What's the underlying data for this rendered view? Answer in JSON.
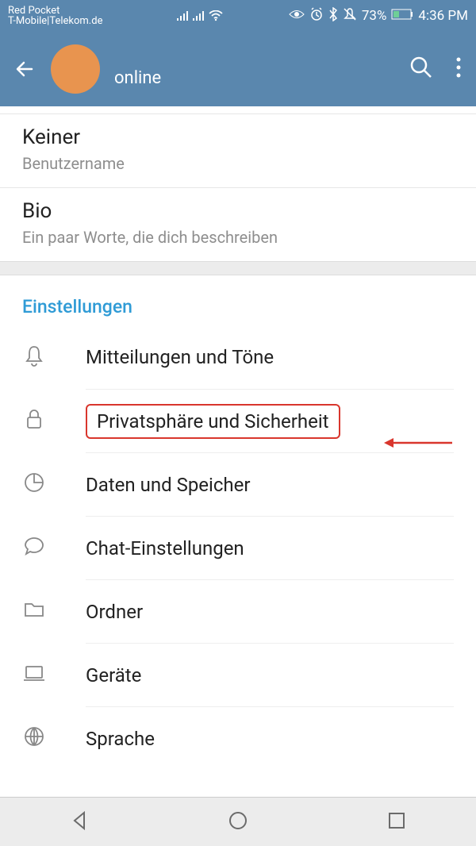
{
  "status_bar": {
    "carrier_line1": "Red Pocket",
    "carrier_line2": "T-Mobile|Telekom.de",
    "battery_pct": "73%",
    "time": "4:36 PM"
  },
  "app_bar": {
    "status_text": "online"
  },
  "profile": {
    "username_value": "Keiner",
    "username_label": "Benutzername",
    "bio_value": "Bio",
    "bio_label": "Ein paar Worte, die dich beschreiben"
  },
  "settings": {
    "header": "Einstellungen",
    "items": [
      {
        "label": "Mitteilungen und Töne",
        "icon": "bell"
      },
      {
        "label": "Privatsphäre und Sicherheit",
        "icon": "lock",
        "highlighted": true
      },
      {
        "label": "Daten und Speicher",
        "icon": "pie"
      },
      {
        "label": "Chat-Einstellungen",
        "icon": "chat"
      },
      {
        "label": "Ordner",
        "icon": "folder"
      },
      {
        "label": "Geräte",
        "icon": "device"
      },
      {
        "label": "Sprache",
        "icon": "globe"
      }
    ]
  }
}
